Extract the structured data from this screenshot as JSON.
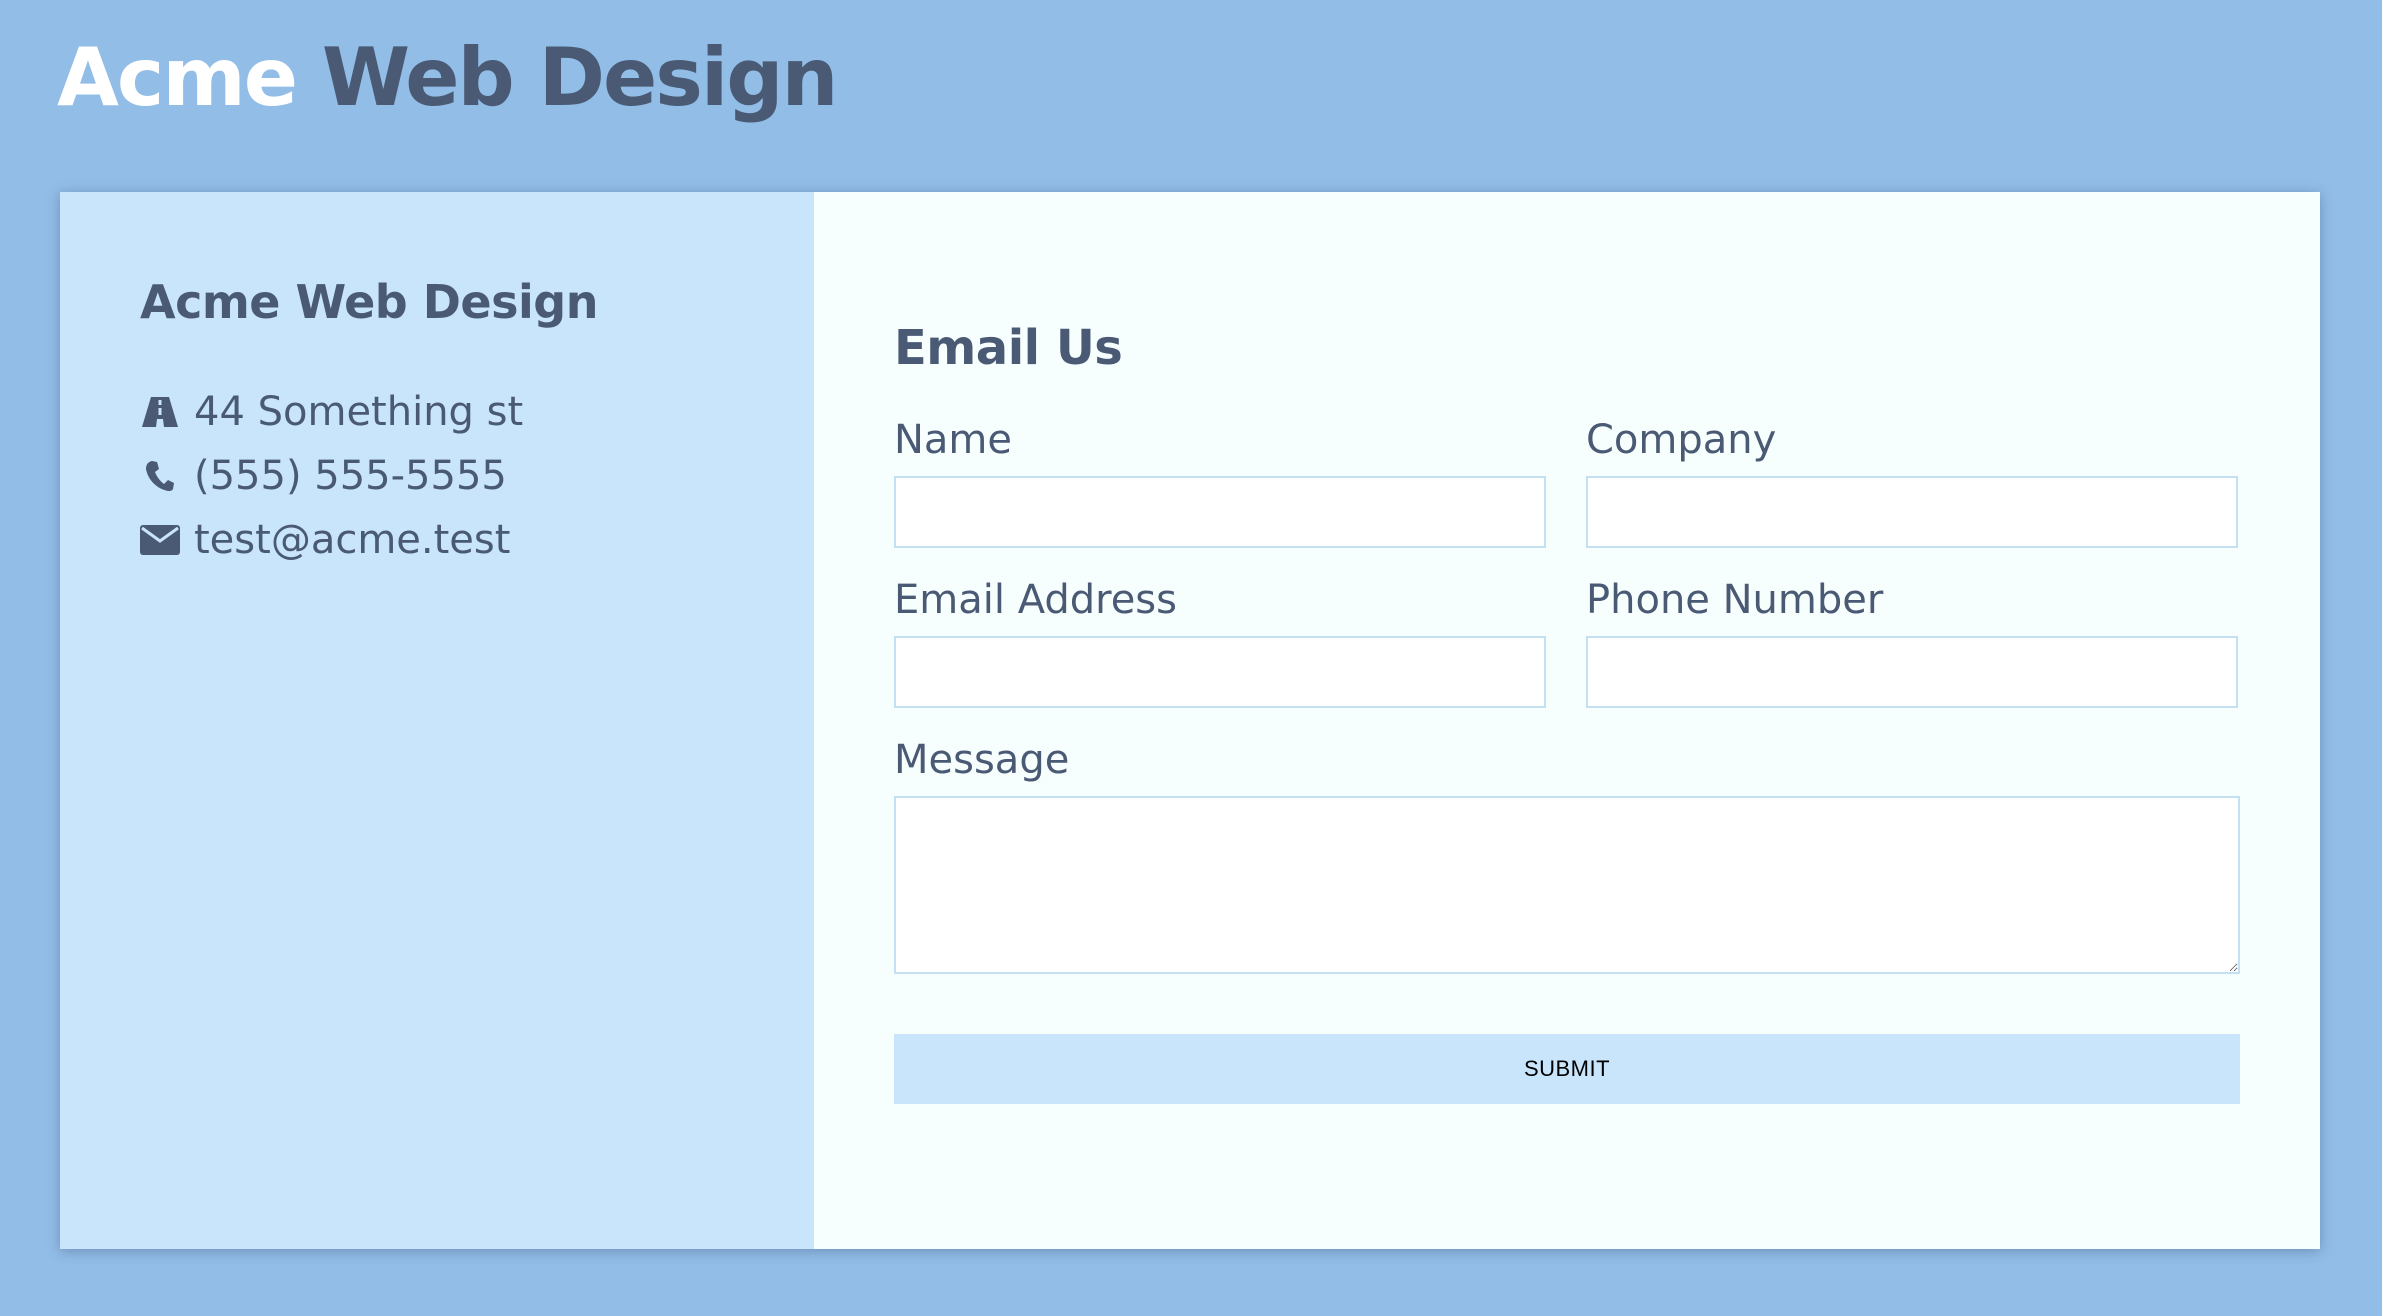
{
  "header": {
    "brand_first": "Acme",
    "brand_rest": "Web Design"
  },
  "company_info": {
    "name": "Acme Web Design",
    "items": [
      {
        "icon": "road-icon",
        "text": "44 Something st"
      },
      {
        "icon": "phone-icon",
        "text": "(555) 555-5555"
      },
      {
        "icon": "envelope-icon",
        "text": "test@acme.test"
      }
    ]
  },
  "form": {
    "title": "Email Us",
    "fields": {
      "name": {
        "label": "Name",
        "value": ""
      },
      "company": {
        "label": "Company",
        "value": ""
      },
      "email": {
        "label": "Email Address",
        "value": ""
      },
      "phone": {
        "label": "Phone Number",
        "value": ""
      },
      "message": {
        "label": "Message",
        "value": ""
      }
    },
    "submit_label": "SUBMIT"
  },
  "colors": {
    "page_background": "#92bde7",
    "brand_highlight": "#ffffff",
    "text": "#4a5a75",
    "info_panel": "#c8e5fb",
    "form_panel": "#f7fefe",
    "input_border": "#c3e1f3",
    "button": "#c8e5fb"
  }
}
